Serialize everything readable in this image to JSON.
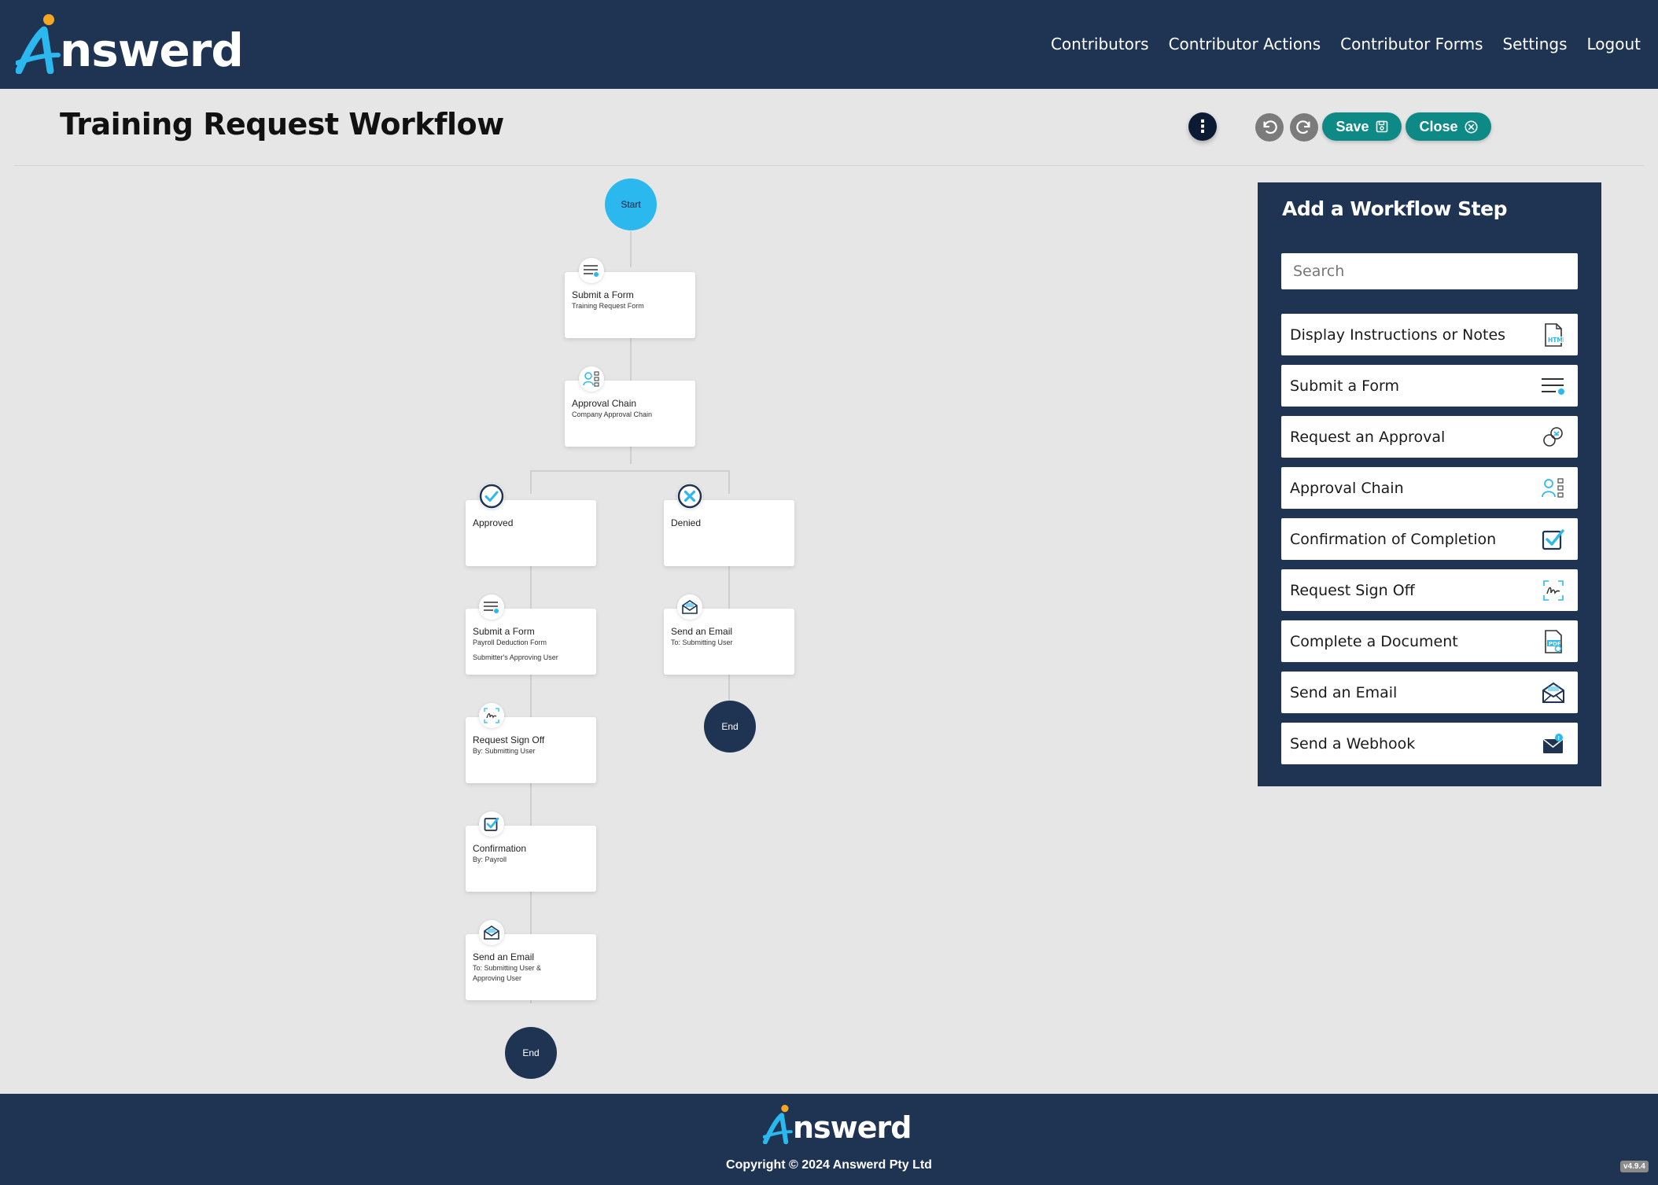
{
  "brand": {
    "name": "nswerd",
    "initial": "A"
  },
  "nav": {
    "items": [
      "Contributors",
      "Contributor Actions",
      "Contributor Forms",
      "Settings",
      "Logout"
    ]
  },
  "page": {
    "title": "Training Request Workflow"
  },
  "toolbar": {
    "more_icon": "kebab-icon",
    "undo_icon": "undo-icon",
    "redo_icon": "redo-icon",
    "save_label": "Save",
    "close_label": "Close"
  },
  "workflow": {
    "start_label": "Start",
    "end_label": "End",
    "nodes": {
      "submit_form": {
        "title": "Submit a Form",
        "subtitle": "Training Request Form",
        "icon": "form-icon"
      },
      "approval_chain": {
        "title": "Approval Chain",
        "subtitle": "Company Approval Chain",
        "icon": "approval-chain-icon"
      },
      "approved": {
        "title": "Approved",
        "icon": "check-circle-icon"
      },
      "denied": {
        "title": "Denied",
        "icon": "x-circle-icon"
      },
      "submit_form_2": {
        "title": "Submit a Form",
        "subtitle": "Payroll Deduction Form",
        "note": "Submitter's Approving User",
        "icon": "form-icon"
      },
      "send_email_denied": {
        "title": "Send an Email",
        "subtitle": "To: Submitting User",
        "icon": "email-icon"
      },
      "sign_off": {
        "title": "Request Sign Off",
        "subtitle": "By: Submitting User",
        "icon": "signature-icon"
      },
      "confirmation": {
        "title": "Confirmation",
        "subtitle": "By: Payroll",
        "icon": "checkbox-icon"
      },
      "send_email_approved": {
        "title": "Send an Email",
        "subtitle": "To: Submitting User &",
        "subtitle2": "Approving User",
        "icon": "email-icon"
      }
    }
  },
  "panel": {
    "title": "Add a Workflow Step",
    "search_placeholder": "Search",
    "steps": [
      {
        "label": "Display Instructions or Notes",
        "icon": "html-doc-icon"
      },
      {
        "label": "Submit a Form",
        "icon": "form-icon"
      },
      {
        "label": "Request an Approval",
        "icon": "approval-icon"
      },
      {
        "label": "Approval Chain",
        "icon": "approval-chain-icon"
      },
      {
        "label": "Confirmation of Completion",
        "icon": "checkbox-icon"
      },
      {
        "label": "Request Sign Off",
        "icon": "signature-icon"
      },
      {
        "label": "Complete a Document",
        "icon": "pdf-doc-icon"
      },
      {
        "label": "Send an Email",
        "icon": "email-icon"
      },
      {
        "label": "Send a Webhook",
        "icon": "webhook-icon"
      }
    ]
  },
  "colors": {
    "navy": "#1f3452",
    "teal": "#0e8a86",
    "cyan": "#2bb8ef",
    "accent": "#f5a623"
  },
  "footer": {
    "copyright": "Copyright © 2024 Answerd Pty Ltd",
    "version": "v4.9.4"
  }
}
